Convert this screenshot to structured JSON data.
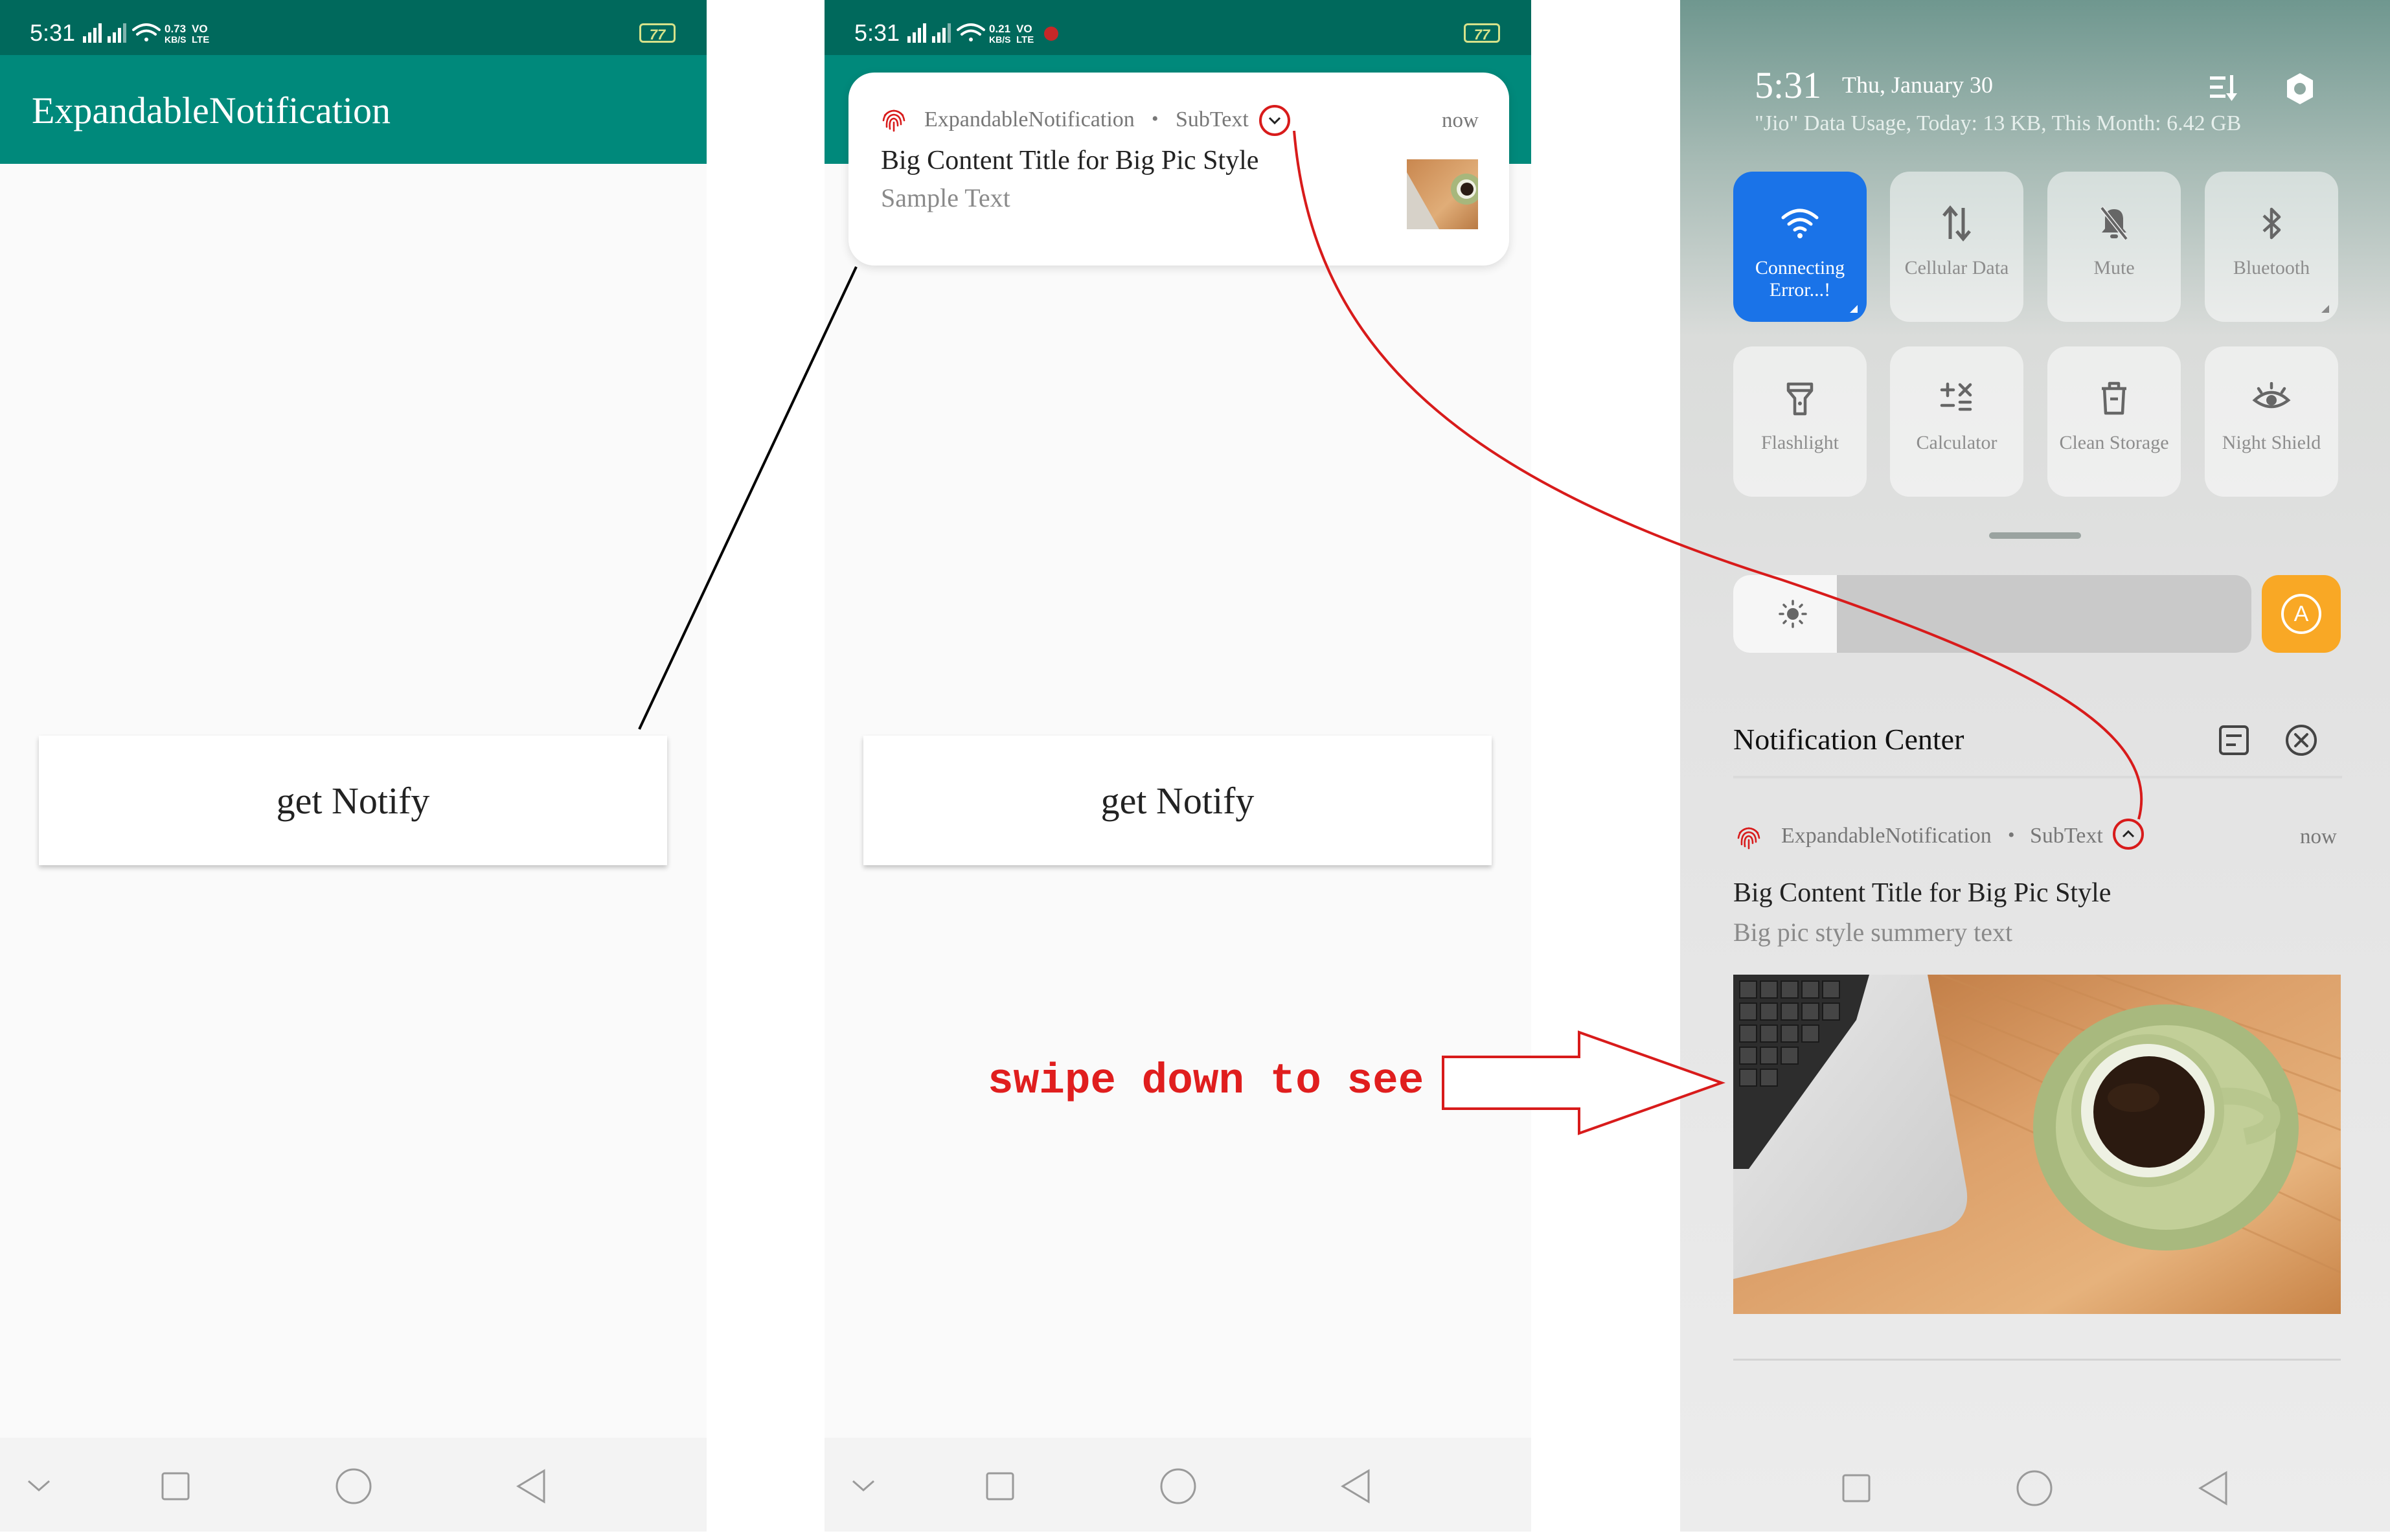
{
  "status_bar_1": {
    "time": "5:31",
    "speed_top": "0.73",
    "speed_bottom": "KB/S",
    "net_top": "VO",
    "net_bottom": "LTE",
    "battery": "77"
  },
  "status_bar_2": {
    "time": "5:31",
    "speed_top": "0.21",
    "speed_bottom": "KB/S",
    "net_top": "VO",
    "net_bottom": "LTE",
    "battery": "77"
  },
  "app": {
    "title": "ExpandableNotification",
    "button_label": "get Notify"
  },
  "notification": {
    "app_name": "ExpandableNotification",
    "separator": "•",
    "subtext": "SubText",
    "time": "now",
    "title": "Big Content Title for Big Pic Style",
    "text": "Sample Text",
    "summary_text": "Big pic style summery text"
  },
  "quick_settings": {
    "time": "5:31",
    "date": "Thu, January 30",
    "data_usage": "\"Jio\" Data Usage, Today: 13 KB, This Month: 6.42 GB",
    "tiles": [
      {
        "label": "Connecting Error...!",
        "icon": "wifi-icon",
        "active": true
      },
      {
        "label": "Cellular Data",
        "icon": "cellular-data-icon",
        "active": false
      },
      {
        "label": "Mute",
        "icon": "mute-bell-icon",
        "active": false
      },
      {
        "label": "Bluetooth",
        "icon": "bluetooth-icon",
        "active": false
      },
      {
        "label": "Flashlight",
        "icon": "flashlight-icon",
        "active": false
      },
      {
        "label": "Calculator",
        "icon": "calculator-icon",
        "active": false
      },
      {
        "label": "Clean Storage",
        "icon": "trash-icon",
        "active": false
      },
      {
        "label": "Night Shield",
        "icon": "eye-icon",
        "active": false
      }
    ],
    "brightness_level": 0.2,
    "auto_brightness_label": "A",
    "notification_center_title": "Notification Center"
  },
  "annotation": {
    "text": "swipe down to see"
  },
  "colors": {
    "primary_dark": "#00695c",
    "primary": "#00897b",
    "accent_red": "#d81b1b",
    "tile_active": "#1a73e8",
    "auto_brightness": "#f9a825"
  }
}
